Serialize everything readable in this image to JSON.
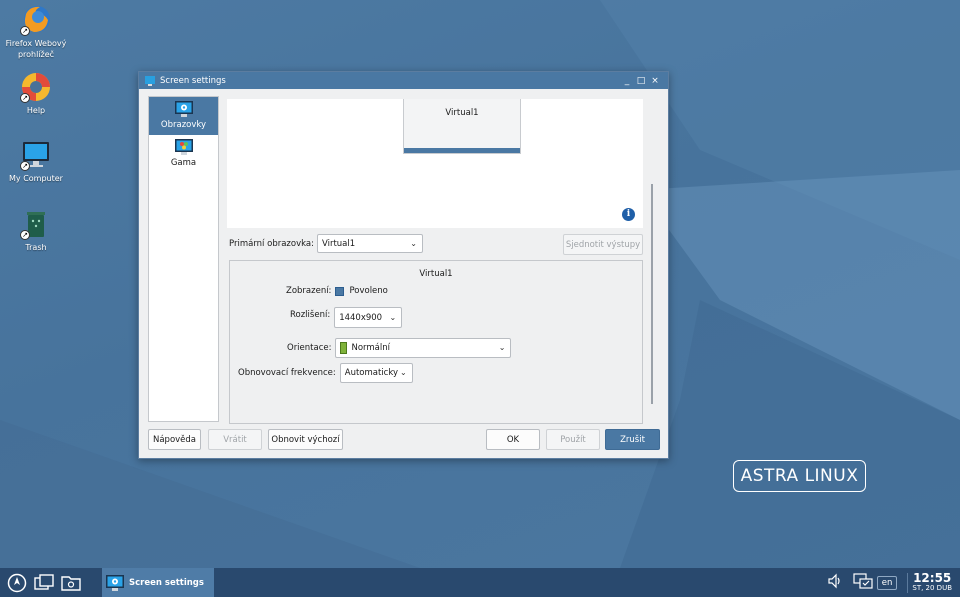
{
  "desktop": {
    "icons": [
      {
        "label": "Firefox Webový prohlížeč"
      },
      {
        "label": "Help"
      },
      {
        "label": "My Computer"
      },
      {
        "label": "Trash"
      }
    ],
    "logo_text": "ASTRA LINUX"
  },
  "window": {
    "title": "Screen settings",
    "controls": {
      "minimize": "_",
      "maximize": "□",
      "close": "×"
    },
    "sidebar": [
      {
        "label": "Obrazovky",
        "active": true
      },
      {
        "label": "Gama",
        "active": false
      }
    ],
    "preview": {
      "monitor_label": "Virtual1"
    },
    "primary_label": "Primární obrazovka:",
    "primary_value": "Virtual1",
    "unify_button": "Sjednotit výstupy",
    "output": {
      "name": "Virtual1",
      "display_label": "Zobrazení:",
      "display_value": "Povoleno",
      "resolution_label": "Rozlišení:",
      "resolution_value": "1440x900",
      "orientation_label": "Orientace:",
      "orientation_value": "Normální",
      "refresh_label": "Obnovovací frekvence:",
      "refresh_value": "Automaticky"
    },
    "buttons": {
      "help": "Nápověda",
      "revert": "Vrátit",
      "defaults": "Obnovit výchozí",
      "ok": "OK",
      "apply": "Použít",
      "cancel": "Zrušit"
    }
  },
  "taskbar": {
    "task_label": "Screen settings",
    "lang": "en",
    "time": "12:55",
    "date": "ST, 20 DUB"
  },
  "colors": {
    "accent": "#4a78a3",
    "taskbar": "#29496e",
    "desktop": "#4a7198"
  }
}
